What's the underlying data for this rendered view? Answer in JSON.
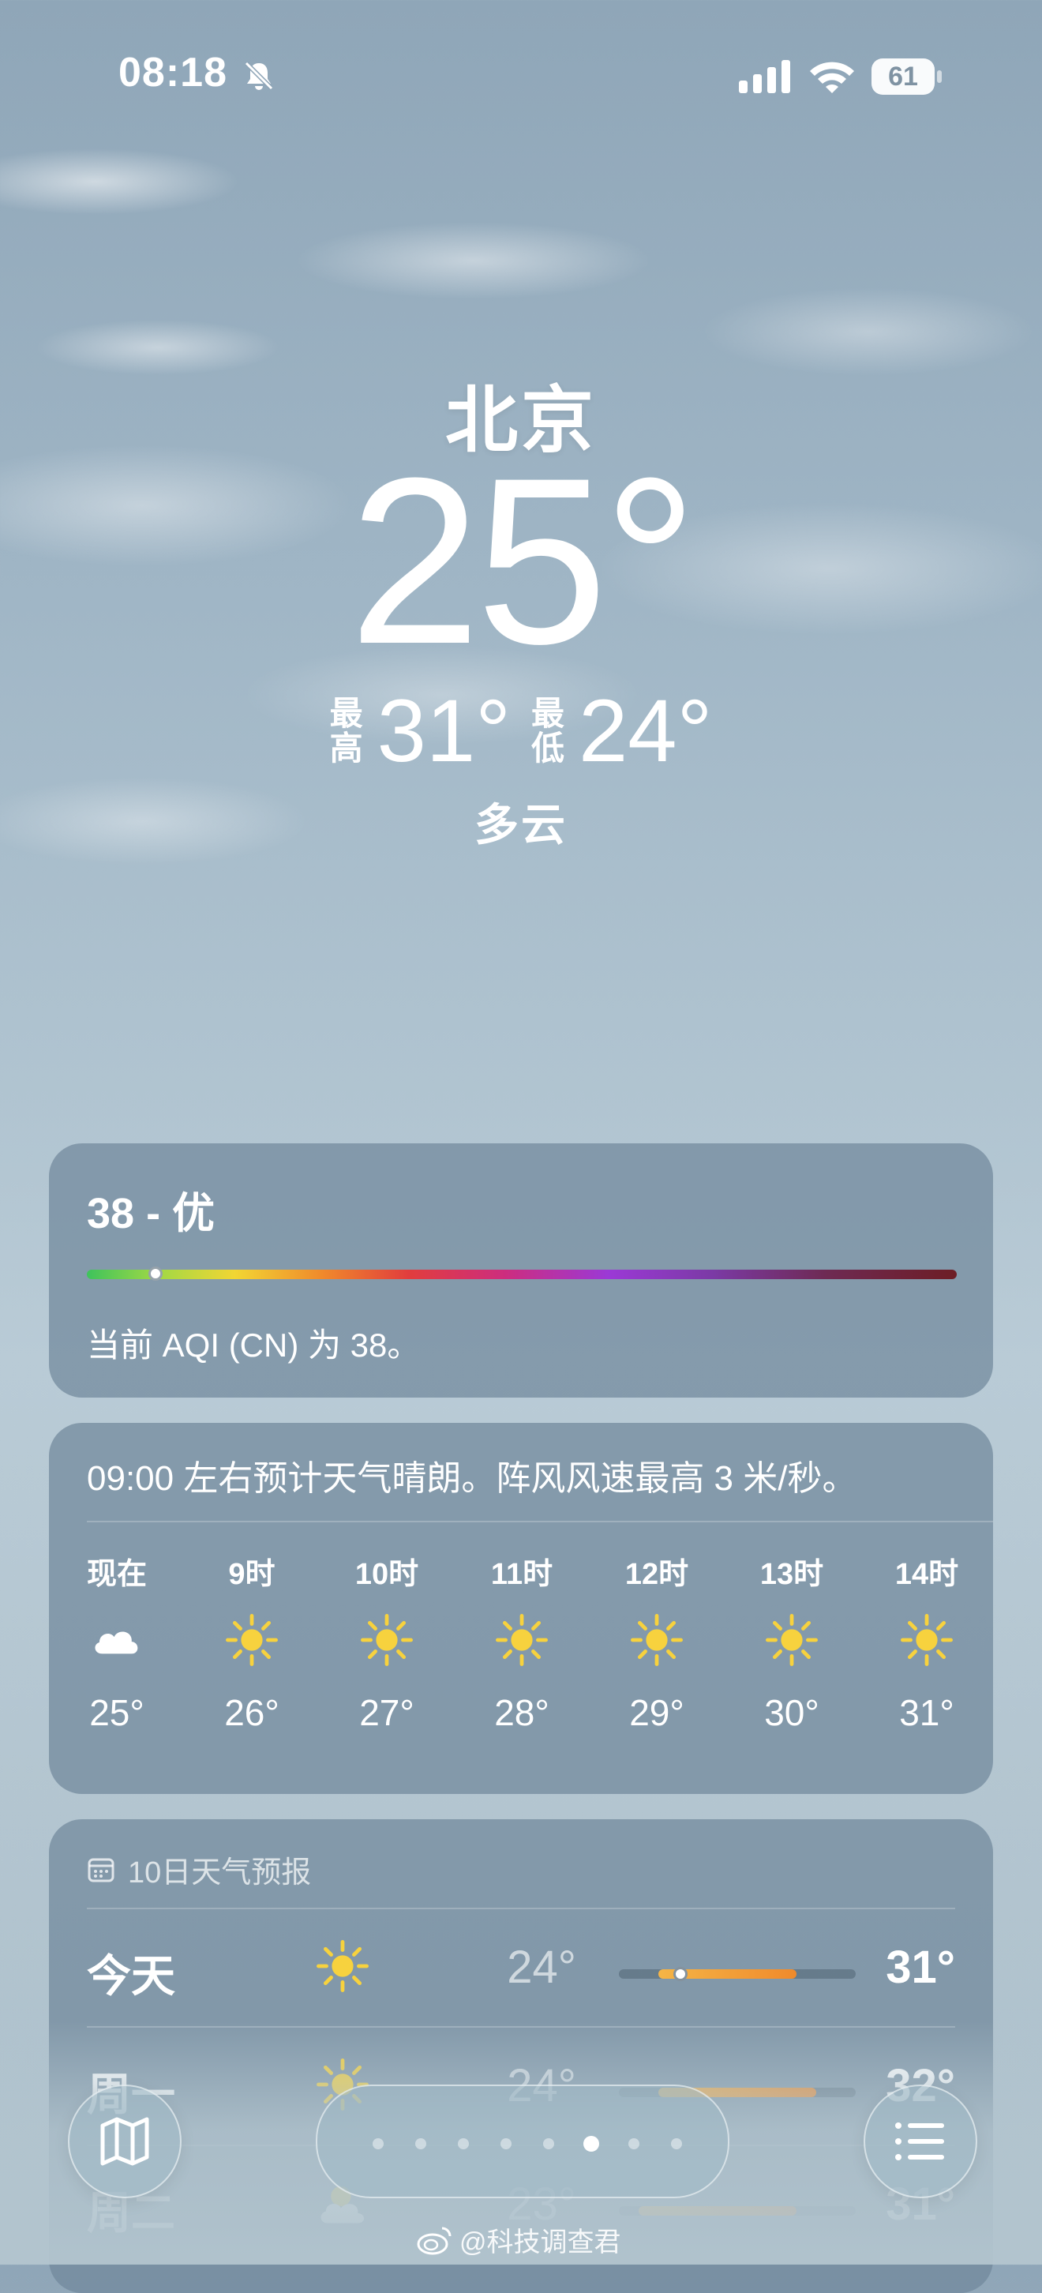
{
  "status_bar": {
    "time": "08:18",
    "battery": "61",
    "icons": [
      "bell-slash-icon",
      "cellular-signal-icon",
      "wifi-icon",
      "battery-icon"
    ]
  },
  "hero": {
    "city": "北京",
    "temperature": "25°",
    "high_label": "最高",
    "high": "31°",
    "low_label": "最低",
    "low": "24°",
    "condition": "多云"
  },
  "aqi": {
    "value_text": "38 - 优",
    "value": 38,
    "description": "当前 AQI (CN) 为 38。"
  },
  "hourly": {
    "summary": "09:00 左右预计天气晴朗。阵风风速最高 3 米/秒。",
    "items": [
      {
        "label": "现在",
        "icon": "cloud-icon",
        "temp": "25°"
      },
      {
        "label": "9时",
        "icon": "sun-icon",
        "temp": "26°"
      },
      {
        "label": "10时",
        "icon": "sun-icon",
        "temp": "27°"
      },
      {
        "label": "11时",
        "icon": "sun-icon",
        "temp": "28°"
      },
      {
        "label": "12时",
        "icon": "sun-icon",
        "temp": "29°"
      },
      {
        "label": "13时",
        "icon": "sun-icon",
        "temp": "30°"
      },
      {
        "label": "14时",
        "icon": "sun-icon",
        "temp": "31°"
      }
    ]
  },
  "daily": {
    "header": "10日天气预报",
    "items": [
      {
        "day": "今天",
        "icon": "sun-icon",
        "low": "24°",
        "high": "31°"
      },
      {
        "day": "周一",
        "icon": "sun-icon",
        "low": "24°",
        "high": "32°"
      },
      {
        "day": "周二",
        "icon": "sun-cloud-icon",
        "low": "23°",
        "high": "31°"
      }
    ]
  },
  "watermark": "@科技调查君",
  "colors": {
    "card": "#70889b",
    "sun": "#f7d23e",
    "range_fill": "#f08a2b"
  }
}
